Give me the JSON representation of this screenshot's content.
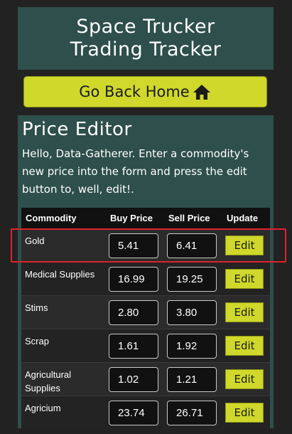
{
  "header": {
    "line1": "Space Trucker",
    "line2": "Trading Tracker"
  },
  "nav": {
    "home_label": "Go Back Home",
    "home_icon": "home-icon"
  },
  "editor": {
    "title": "Price Editor",
    "intro": "Hello, Data-Gatherer. Enter a commodity's new price into the form and press the edit button to, well, edit!.",
    "columns": [
      "Commodity",
      "Buy Price",
      "Sell Price",
      "Update"
    ],
    "edit_label": "Edit",
    "rows": [
      {
        "name": "Gold",
        "buy": "5.41",
        "sell": "6.41"
      },
      {
        "name": "Medical Supplies",
        "buy": "16.99",
        "sell": "19.25"
      },
      {
        "name": "Stims",
        "buy": "2.80",
        "sell": "3.80"
      },
      {
        "name": "Scrap",
        "buy": "1.61",
        "sell": "1.92"
      },
      {
        "name": "Agricultural Supplies",
        "buy": "1.02",
        "sell": "1.21"
      },
      {
        "name": "Agricium",
        "buy": "23.74",
        "sell": "26.71"
      }
    ]
  },
  "colors": {
    "accent": "#cfd82b",
    "panel": "#2e4f4b",
    "highlight": "#e0222a"
  }
}
